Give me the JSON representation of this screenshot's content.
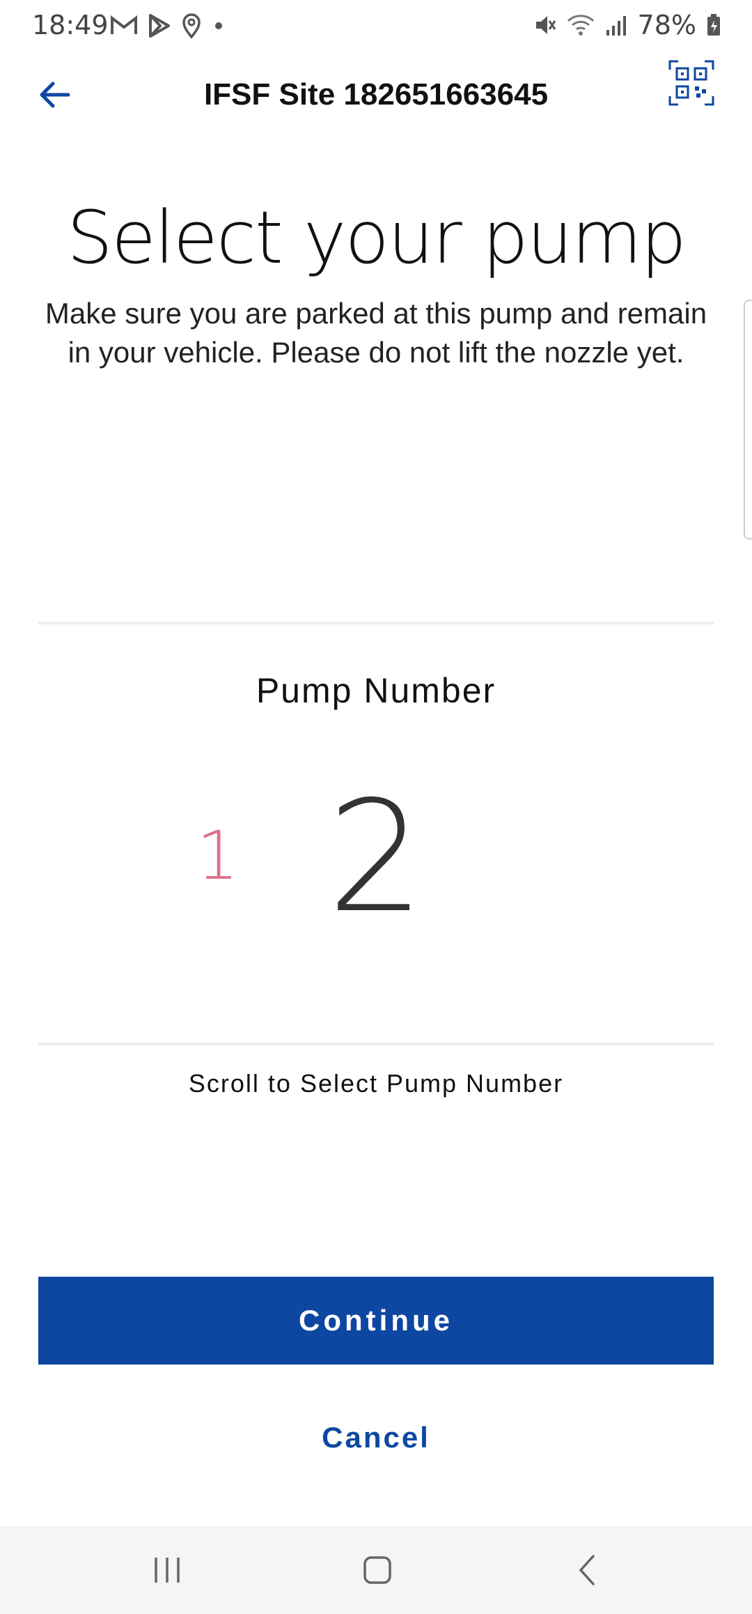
{
  "status_bar": {
    "time": "18:49",
    "battery_percent": "78%",
    "left_icons": [
      "gmail-icon",
      "play-store-icon",
      "location-icon",
      "dot-icon"
    ],
    "right_icons": [
      "mute-icon",
      "wifi-icon",
      "signal-icon",
      "battery-icon"
    ]
  },
  "app_bar": {
    "title": "IFSF Site 182651663645",
    "back_icon": "arrow-left-icon",
    "qr_icon": "qr-code-icon"
  },
  "heading": "Select your pump",
  "subtext": "Make sure you are parked at this pump and remain in your vehicle. Please do not lift the nozzle yet.",
  "picker": {
    "label": "Pump Number",
    "previous_value": "1",
    "current_value": "2",
    "hint": "Scroll to Select Pump Number"
  },
  "actions": {
    "continue_label": "Continue",
    "cancel_label": "Cancel"
  },
  "colors": {
    "primary": "#0d47a1",
    "prev_number": "#e0708a"
  },
  "nav_bar": [
    "recents-icon",
    "home-icon",
    "back-chevron-icon"
  ]
}
